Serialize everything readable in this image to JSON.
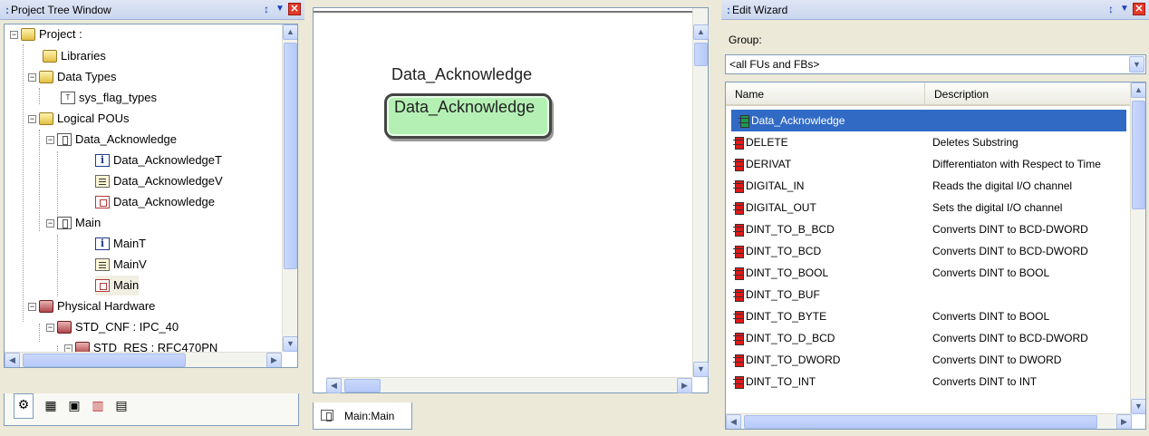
{
  "colors": {
    "fu_icon": "#e01818",
    "fb_icon": "#1a9a50",
    "selection": "#316ac5",
    "fb_fill": "#b4f0b4"
  },
  "project_tree": {
    "title": "Project Tree Window",
    "nodes": [
      {
        "label": "Project :",
        "icon": "folder-icon"
      },
      {
        "label": "Libraries",
        "icon": "folder-icon"
      },
      {
        "label": "Data Types",
        "icon": "folder-icon"
      },
      {
        "label": "sys_flag_types",
        "icon": "datatype-icon"
      },
      {
        "label": "Logical POUs",
        "icon": "folder-icon"
      },
      {
        "label": "Data_Acknowledge",
        "icon": "pou-icon"
      },
      {
        "label": "Data_AcknowledgeT",
        "icon": "info-icon"
      },
      {
        "label": "Data_AcknowledgeV",
        "icon": "variables-icon"
      },
      {
        "label": "Data_Acknowledge",
        "icon": "code-icon"
      },
      {
        "label": "Main",
        "icon": "pou-icon"
      },
      {
        "label": "MainT",
        "icon": "info-icon"
      },
      {
        "label": "MainV",
        "icon": "variables-icon"
      },
      {
        "label": "Main",
        "icon": "code-icon"
      },
      {
        "label": "Physical Hardware",
        "icon": "hardware-folder-icon"
      },
      {
        "label": "STD_CNF : IPC_40",
        "icon": "hardware-folder-icon"
      },
      {
        "label": "STD_RES : RFC470PN",
        "icon": "hardware-folder-icon"
      }
    ],
    "tabs": [
      "project-tab",
      "instance-tab",
      "library-tab",
      "tasks-tab",
      "variables-tab"
    ]
  },
  "editor": {
    "fb_instance_label": "Data_Acknowledge",
    "fb_type_label": "Data_Acknowledge",
    "tab_label": "Main:Main"
  },
  "wizard": {
    "title": "Edit Wizard",
    "group_label": "Group:",
    "group_value": "<all FUs and FBs>",
    "columns": [
      "Name",
      "Description"
    ],
    "rows": [
      {
        "name": "Data_Acknowledge",
        "description": "",
        "kind": "fb"
      },
      {
        "name": "DELETE",
        "description": "Deletes Substring",
        "kind": "fu"
      },
      {
        "name": "DERIVAT",
        "description": "Differentiaton with Respect to Time",
        "kind": "fu"
      },
      {
        "name": "DIGITAL_IN",
        "description": "Reads the digital I/O channel",
        "kind": "fu"
      },
      {
        "name": "DIGITAL_OUT",
        "description": "Sets the digital I/O channel",
        "kind": "fu"
      },
      {
        "name": "DINT_TO_B_BCD",
        "description": "Converts DINT to BCD-DWORD",
        "kind": "fu"
      },
      {
        "name": "DINT_TO_BCD",
        "description": "Converts DINT to BCD-DWORD",
        "kind": "fu"
      },
      {
        "name": "DINT_TO_BOOL",
        "description": "Converts DINT to BOOL",
        "kind": "fu"
      },
      {
        "name": "DINT_TO_BUF",
        "description": "",
        "kind": "fu"
      },
      {
        "name": "DINT_TO_BYTE",
        "description": "Converts DINT to BOOL",
        "kind": "fu"
      },
      {
        "name": "DINT_TO_D_BCD",
        "description": "Converts DINT to BCD-DWORD",
        "kind": "fu"
      },
      {
        "name": "DINT_TO_DWORD",
        "description": "Converts DINT to DWORD",
        "kind": "fu"
      },
      {
        "name": "DINT_TO_INT",
        "description": "Converts DINT to INT",
        "kind": "fu"
      }
    ]
  }
}
